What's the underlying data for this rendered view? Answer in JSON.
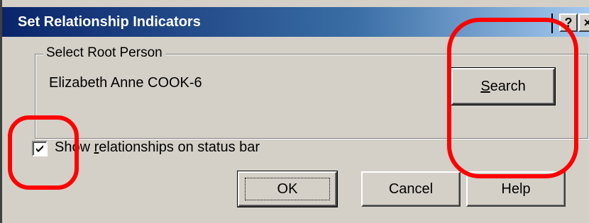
{
  "window": {
    "title": "Set Relationship Indicators",
    "help_glyph": "?",
    "close_glyph": "×"
  },
  "root_person": {
    "group_label": "Select Root Person",
    "name": "Elizabeth Anne COOK-6",
    "search_label": "Search",
    "search_mnemonic": "S",
    "search_rest": "earch"
  },
  "status_option": {
    "checked": true,
    "label_before": "Show ",
    "label_mnemonic": "r",
    "label_after": "elationships on status bar"
  },
  "buttons": {
    "ok": "OK",
    "cancel": "Cancel",
    "help": "Help"
  },
  "annotations": {
    "color": "#ff0000"
  }
}
